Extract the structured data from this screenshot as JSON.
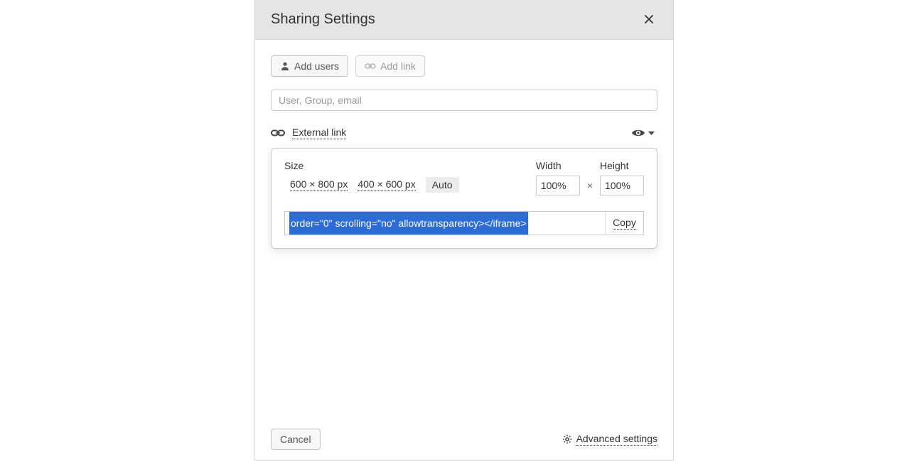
{
  "header": {
    "title": "Sharing Settings"
  },
  "toolbar": {
    "add_users_label": "Add users",
    "add_link_label": "Add link"
  },
  "search": {
    "placeholder": "User, Group, email"
  },
  "link_section": {
    "label": "External link",
    "size_label": "Size",
    "presets": {
      "p1": "600 × 800 px",
      "p2": "400 × 600 px",
      "auto": "Auto"
    },
    "width_label": "Width",
    "height_label": "Height",
    "width_value": "100%",
    "height_value": "100%",
    "dim_separator": "×",
    "embed_selected_text": "order=\"0\" scrolling=\"no\" allowtransparency></iframe>",
    "copy_label": "Copy"
  },
  "footer": {
    "cancel_label": "Cancel",
    "advanced_label": "Advanced settings"
  }
}
